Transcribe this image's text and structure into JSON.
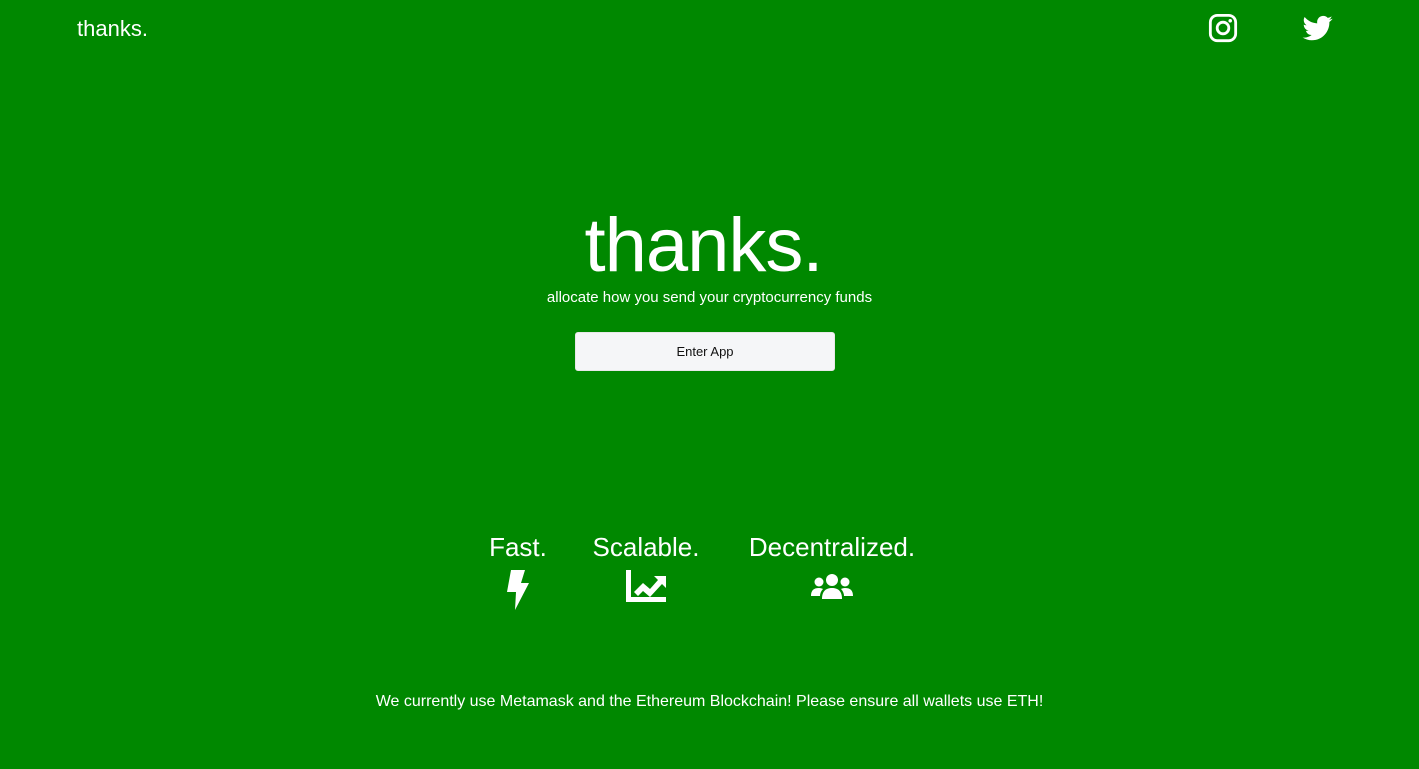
{
  "nav": {
    "logo": "thanks.",
    "social": [
      {
        "icon": "instagram-icon"
      },
      {
        "icon": "twitter-icon"
      }
    ]
  },
  "hero": {
    "title": "thanks.",
    "subtitle": "allocate how you send your cryptocurrency funds",
    "button_label": "Enter App"
  },
  "features": [
    {
      "label": "Fast.",
      "icon": "lightning-bolt-icon"
    },
    {
      "label": "Scalable.",
      "icon": "chart-line-icon"
    },
    {
      "label": "Decentralized.",
      "icon": "users-group-icon"
    }
  ],
  "footer": {
    "note": "We currently use Metamask and the Ethereum Blockchain! Please ensure all wallets use ETH!"
  },
  "colors": {
    "background": "#008800",
    "text": "#ffffff",
    "button_bg": "#f5f6f8",
    "button_text": "#111111"
  }
}
